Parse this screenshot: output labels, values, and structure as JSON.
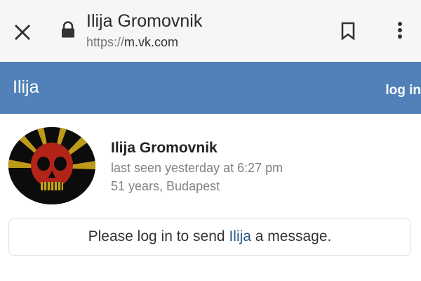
{
  "browser": {
    "title": "Ilija Gromovnik",
    "url_scheme": "https://",
    "url_host": "m.vk.com"
  },
  "header": {
    "title": "Ilija",
    "login_label": "log in"
  },
  "profile": {
    "name": "Ilija Gromovnik",
    "last_seen": "last seen yesterday at 6:27 pm",
    "info": "51 years, Budapest"
  },
  "message": {
    "text_before": "Please log in to send ",
    "name_link": "Ilija",
    "text_after": " a message."
  },
  "icons": {
    "close": "close-icon",
    "lock": "lock-icon",
    "bookmark": "bookmark-icon",
    "menu": "more-vert-icon"
  },
  "colors": {
    "brand_blue": "#5181b8",
    "link_blue": "#2a5885",
    "secondary_text": "#828282"
  }
}
